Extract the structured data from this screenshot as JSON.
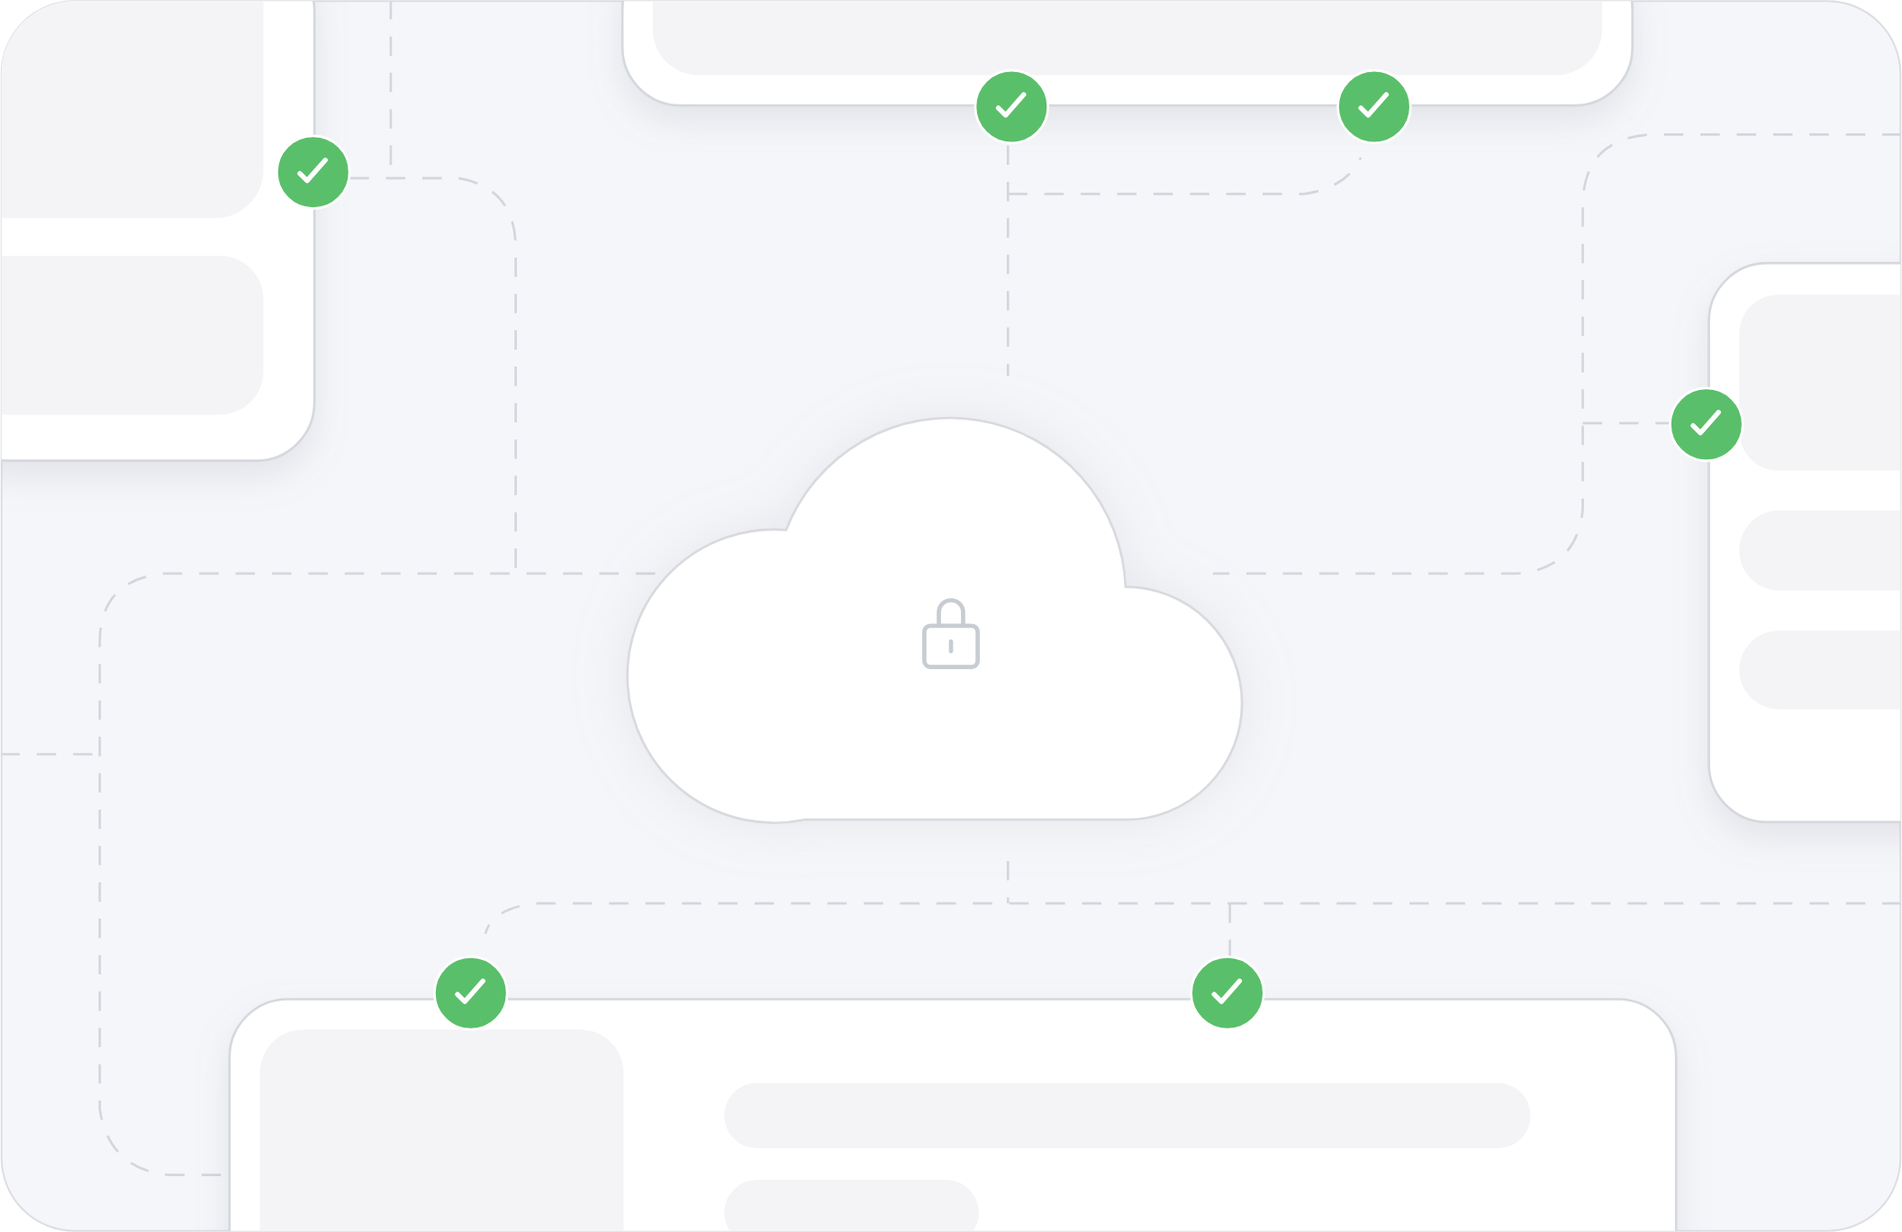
{
  "cloud": {
    "locked": true
  },
  "status_badges": [
    {
      "checked": true
    },
    {
      "checked": true
    },
    {
      "checked": true
    },
    {
      "checked": true
    },
    {
      "checked": true
    },
    {
      "checked": true
    }
  ]
}
